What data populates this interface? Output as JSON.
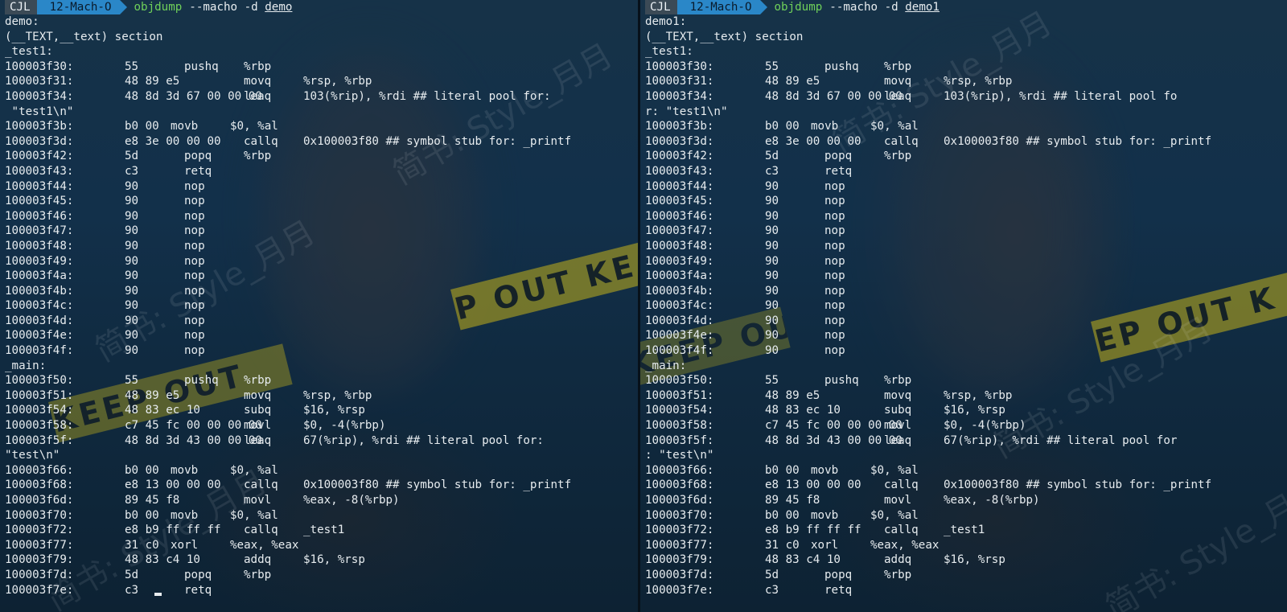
{
  "colors": {
    "background": "#12304a",
    "text": "#e7ecef",
    "command": "#6fd05a",
    "user_segment": "#3b4a56",
    "dir_segment": "#2a87c8",
    "tape": "#c4b21a"
  },
  "backdrop": {
    "tape_left": "P OUT KE",
    "tape_right": "EP OUT K",
    "tape_lower": "KEEP OUT",
    "watermark": "简书: Style_月月"
  },
  "left": {
    "prompt": {
      "user": "CJL",
      "dir": "12-Mach-O",
      "cmd": "objdump",
      "args": "--macho -d",
      "file": "demo"
    },
    "lines": [
      {
        "t": "demo:"
      },
      {
        "t": "(__TEXT,__text) section"
      },
      {
        "t": "_test1:"
      },
      {
        "a": "100003f30:",
        "b": "55",
        "o": "pushq",
        "r": "%rbp",
        "L": "s"
      },
      {
        "a": "100003f31:",
        "b": "48 89 e5",
        "o": "movq",
        "r": "%rsp, %rbp",
        "L": "w"
      },
      {
        "a": "100003f34:",
        "b": "48 8d 3d 67 00 00 00",
        "o": "leaq",
        "r": "103(%rip), %rdi ## literal pool for:",
        "L": "w"
      },
      {
        "t": " \"test1\\n\""
      },
      {
        "a": "100003f3b:",
        "b": "b0 00",
        "o": "movb",
        "r": "$0, %al",
        "L": "m"
      },
      {
        "a": "100003f3d:",
        "b": "e8 3e 00 00 00",
        "o": "callq",
        "r": "0x100003f80 ## symbol stub for: _printf",
        "L": "m"
      },
      {
        "a": "100003f42:",
        "b": "5d",
        "o": "popq",
        "r": "%rbp",
        "L": "s"
      },
      {
        "a": "100003f43:",
        "b": "c3",
        "o": "retq",
        "r": "",
        "L": "s"
      },
      {
        "a": "100003f44:",
        "b": "90",
        "o": "nop",
        "r": "",
        "L": "s"
      },
      {
        "a": "100003f45:",
        "b": "90",
        "o": "nop",
        "r": "",
        "L": "s"
      },
      {
        "a": "100003f46:",
        "b": "90",
        "o": "nop",
        "r": "",
        "L": "s"
      },
      {
        "a": "100003f47:",
        "b": "90",
        "o": "nop",
        "r": "",
        "L": "s"
      },
      {
        "a": "100003f48:",
        "b": "90",
        "o": "nop",
        "r": "",
        "L": "s"
      },
      {
        "a": "100003f49:",
        "b": "90",
        "o": "nop",
        "r": "",
        "L": "s"
      },
      {
        "a": "100003f4a:",
        "b": "90",
        "o": "nop",
        "r": "",
        "L": "s"
      },
      {
        "a": "100003f4b:",
        "b": "90",
        "o": "nop",
        "r": "",
        "L": "s"
      },
      {
        "a": "100003f4c:",
        "b": "90",
        "o": "nop",
        "r": "",
        "L": "s"
      },
      {
        "a": "100003f4d:",
        "b": "90",
        "o": "nop",
        "r": "",
        "L": "s"
      },
      {
        "a": "100003f4e:",
        "b": "90",
        "o": "nop",
        "r": "",
        "L": "s"
      },
      {
        "a": "100003f4f:",
        "b": "90",
        "o": "nop",
        "r": "",
        "L": "s"
      },
      {
        "t": "_main:"
      },
      {
        "a": "100003f50:",
        "b": "55",
        "o": "pushq",
        "r": "%rbp",
        "L": "s"
      },
      {
        "a": "100003f51:",
        "b": "48 89 e5",
        "o": "movq",
        "r": "%rsp, %rbp",
        "L": "w"
      },
      {
        "a": "100003f54:",
        "b": "48 83 ec 10",
        "o": "subq",
        "r": "$16, %rsp",
        "L": "w"
      },
      {
        "a": "100003f58:",
        "b": "c7 45 fc 00 00 00 00",
        "o": "movl",
        "r": "$0, -4(%rbp)",
        "L": "w"
      },
      {
        "a": "100003f5f:",
        "b": "48 8d 3d 43 00 00 00",
        "o": "leaq",
        "r": "67(%rip), %rdi ## literal pool for:",
        "L": "w"
      },
      {
        "t": "\"test\\n\""
      },
      {
        "a": "100003f66:",
        "b": "b0 00",
        "o": "movb",
        "r": "$0, %al",
        "L": "m"
      },
      {
        "a": "100003f68:",
        "b": "e8 13 00 00 00",
        "o": "callq",
        "r": "0x100003f80 ## symbol stub for: _printf",
        "L": "m"
      },
      {
        "a": "100003f6d:",
        "b": "89 45 f8",
        "o": "movl",
        "r": "%eax, -8(%rbp)",
        "L": "w"
      },
      {
        "a": "100003f70:",
        "b": "b0 00",
        "o": "movb",
        "r": "$0, %al",
        "L": "m"
      },
      {
        "a": "100003f72:",
        "b": "e8 b9 ff ff ff",
        "o": "callq",
        "r": "_test1",
        "L": "m"
      },
      {
        "a": "100003f77:",
        "b": "31 c0",
        "o": "xorl",
        "r": "%eax, %eax",
        "L": "m"
      },
      {
        "a": "100003f79:",
        "b": "48 83 c4 10",
        "o": "addq",
        "r": "$16, %rsp",
        "L": "w"
      },
      {
        "a": "100003f7d:",
        "b": "5d",
        "o": "popq",
        "r": "%rbp",
        "L": "s"
      },
      {
        "a": "100003f7e:",
        "b": "c3",
        "o": "retq",
        "r": "",
        "L": "s",
        "cursor": true
      }
    ]
  },
  "right": {
    "prompt": {
      "user": "CJL",
      "dir": "12-Mach-O",
      "cmd": "objdump",
      "args": "--macho -d",
      "file": "demo1"
    },
    "lines": [
      {
        "t": "demo1:"
      },
      {
        "t": "(__TEXT,__text) section"
      },
      {
        "t": "_test1:"
      },
      {
        "a": "100003f30:",
        "b": "55",
        "o": "pushq",
        "r": "%rbp",
        "L": "s"
      },
      {
        "a": "100003f31:",
        "b": "48 89 e5",
        "o": "movq",
        "r": "%rsp, %rbp",
        "L": "w"
      },
      {
        "a": "100003f34:",
        "b": "48 8d 3d 67 00 00 00",
        "o": "leaq",
        "r": "103(%rip), %rdi ## literal pool fo",
        "L": "w"
      },
      {
        "t": "r: \"test1\\n\""
      },
      {
        "a": "100003f3b:",
        "b": "b0 00",
        "o": "movb",
        "r": "$0, %al",
        "L": "m"
      },
      {
        "a": "100003f3d:",
        "b": "e8 3e 00 00 00",
        "o": "callq",
        "r": "0x100003f80 ## symbol stub for: _printf",
        "L": "m"
      },
      {
        "a": "100003f42:",
        "b": "5d",
        "o": "popq",
        "r": "%rbp",
        "L": "s"
      },
      {
        "a": "100003f43:",
        "b": "c3",
        "o": "retq",
        "r": "",
        "L": "s"
      },
      {
        "a": "100003f44:",
        "b": "90",
        "o": "nop",
        "r": "",
        "L": "s"
      },
      {
        "a": "100003f45:",
        "b": "90",
        "o": "nop",
        "r": "",
        "L": "s"
      },
      {
        "a": "100003f46:",
        "b": "90",
        "o": "nop",
        "r": "",
        "L": "s"
      },
      {
        "a": "100003f47:",
        "b": "90",
        "o": "nop",
        "r": "",
        "L": "s"
      },
      {
        "a": "100003f48:",
        "b": "90",
        "o": "nop",
        "r": "",
        "L": "s"
      },
      {
        "a": "100003f49:",
        "b": "90",
        "o": "nop",
        "r": "",
        "L": "s"
      },
      {
        "a": "100003f4a:",
        "b": "90",
        "o": "nop",
        "r": "",
        "L": "s"
      },
      {
        "a": "100003f4b:",
        "b": "90",
        "o": "nop",
        "r": "",
        "L": "s"
      },
      {
        "a": "100003f4c:",
        "b": "90",
        "o": "nop",
        "r": "",
        "L": "s"
      },
      {
        "a": "100003f4d:",
        "b": "90",
        "o": "nop",
        "r": "",
        "L": "s"
      },
      {
        "a": "100003f4e:",
        "b": "90",
        "o": "nop",
        "r": "",
        "L": "s"
      },
      {
        "a": "100003f4f:",
        "b": "90",
        "o": "nop",
        "r": "",
        "L": "s"
      },
      {
        "t": "_main:"
      },
      {
        "a": "100003f50:",
        "b": "55",
        "o": "pushq",
        "r": "%rbp",
        "L": "s"
      },
      {
        "a": "100003f51:",
        "b": "48 89 e5",
        "o": "movq",
        "r": "%rsp, %rbp",
        "L": "w"
      },
      {
        "a": "100003f54:",
        "b": "48 83 ec 10",
        "o": "subq",
        "r": "$16, %rsp",
        "L": "w"
      },
      {
        "a": "100003f58:",
        "b": "c7 45 fc 00 00 00 00",
        "o": "movl",
        "r": "$0, -4(%rbp)",
        "L": "w"
      },
      {
        "a": "100003f5f:",
        "b": "48 8d 3d 43 00 00 00",
        "o": "leaq",
        "r": "67(%rip), %rdi ## literal pool for",
        "L": "w"
      },
      {
        "t": ": \"test\\n\""
      },
      {
        "a": "100003f66:",
        "b": "b0 00",
        "o": "movb",
        "r": "$0, %al",
        "L": "m"
      },
      {
        "a": "100003f68:",
        "b": "e8 13 00 00 00",
        "o": "callq",
        "r": "0x100003f80 ## symbol stub for: _printf",
        "L": "m"
      },
      {
        "a": "100003f6d:",
        "b": "89 45 f8",
        "o": "movl",
        "r": "%eax, -8(%rbp)",
        "L": "m"
      },
      {
        "a": "100003f70:",
        "b": "b0 00",
        "o": "movb",
        "r": "$0, %al",
        "L": "m"
      },
      {
        "a": "100003f72:",
        "b": "e8 b9 ff ff ff",
        "o": "callq",
        "r": "_test1",
        "L": "m"
      },
      {
        "a": "100003f77:",
        "b": "31 c0",
        "o": "xorl",
        "r": "%eax, %eax",
        "L": "m"
      },
      {
        "a": "100003f79:",
        "b": "48 83 c4 10",
        "o": "addq",
        "r": "$16, %rsp",
        "L": "m"
      },
      {
        "a": "100003f7d:",
        "b": "5d",
        "o": "popq",
        "r": "%rbp",
        "L": "s"
      },
      {
        "a": "100003f7e:",
        "b": "c3",
        "o": "retq",
        "r": "",
        "L": "s"
      }
    ]
  }
}
